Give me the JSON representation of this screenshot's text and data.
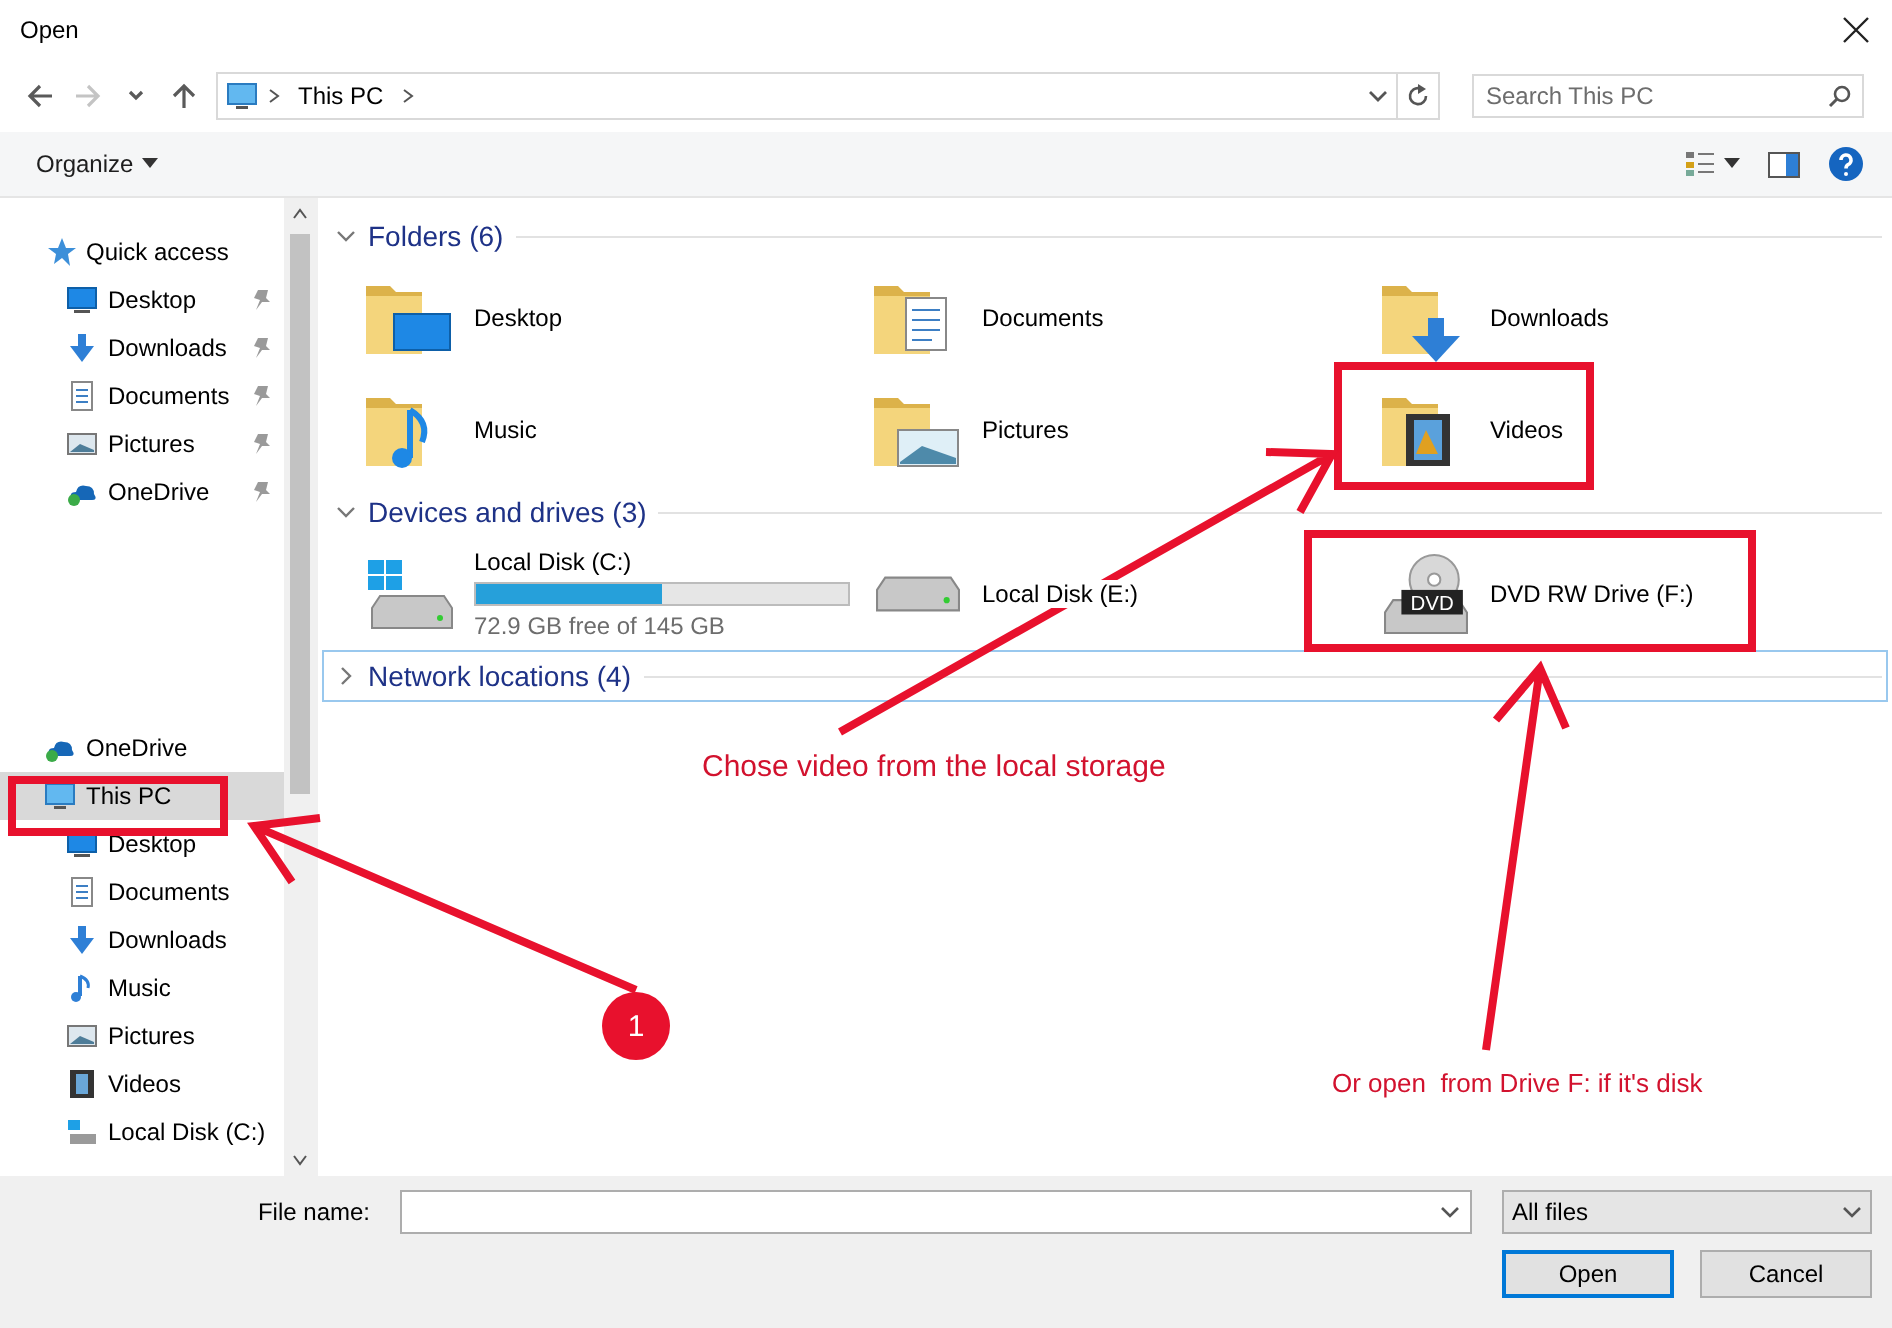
{
  "window": {
    "title": "Open"
  },
  "nav": {
    "buttons": [
      {
        "kind": "back",
        "disabled": false
      },
      {
        "kind": "forward",
        "disabled": true
      },
      {
        "kind": "recent",
        "disabled": false
      },
      {
        "kind": "up",
        "disabled": false
      }
    ],
    "address": {
      "path": [
        "This PC"
      ]
    },
    "search": {
      "placeholder": "Search This PC"
    }
  },
  "toolbar": {
    "organize": "Organize"
  },
  "sidebar": {
    "sections": [
      [
        {
          "label": "Quick access",
          "kind": "star",
          "selected": false,
          "children": [
            {
              "label": "Desktop",
              "kind": "desktop",
              "selected": false,
              "pinned": true
            },
            {
              "label": "Downloads",
              "kind": "downloads",
              "selected": false,
              "pinned": true
            },
            {
              "label": "Documents",
              "kind": "documents",
              "selected": false,
              "pinned": true
            },
            {
              "label": "Pictures",
              "kind": "pictures",
              "selected": false,
              "pinned": true
            },
            {
              "label": "OneDrive",
              "kind": "onedrive",
              "selected": false,
              "pinned": true
            }
          ]
        }
      ],
      [
        {
          "label": "OneDrive",
          "kind": "onedrive",
          "selected": false
        },
        {
          "label": "This PC",
          "kind": "pc",
          "selected": true,
          "children": [
            {
              "label": "Desktop",
              "kind": "desktop",
              "selected": false,
              "pinned": false
            },
            {
              "label": "Documents",
              "kind": "documents",
              "selected": false,
              "pinned": false
            },
            {
              "label": "Downloads",
              "kind": "downloads",
              "selected": false,
              "pinned": false
            },
            {
              "label": "Music",
              "kind": "music",
              "selected": false,
              "pinned": false
            },
            {
              "label": "Pictures",
              "kind": "pictures",
              "selected": false,
              "pinned": false
            },
            {
              "label": "Videos",
              "kind": "videos",
              "selected": false,
              "pinned": false
            },
            {
              "label": "Local Disk (C:)",
              "kind": "windows-disk",
              "selected": false,
              "pinned": false
            }
          ]
        }
      ]
    ]
  },
  "content": {
    "sections": [
      {
        "title": "Folders (6)",
        "expanded": true,
        "focused": false,
        "items": [
          {
            "name": "Desktop",
            "kind": "desktop"
          },
          {
            "name": "Documents",
            "kind": "documents"
          },
          {
            "name": "Downloads",
            "kind": "downloads"
          },
          {
            "name": "Music",
            "kind": "music"
          },
          {
            "name": "Pictures",
            "kind": "pictures"
          },
          {
            "name": "Videos",
            "kind": "videos"
          }
        ]
      },
      {
        "title": "Devices and drives (3)",
        "expanded": true,
        "focused": false,
        "items": [
          {
            "name": "Local Disk (C:)",
            "kind": "windows-disk",
            "level": 0.5,
            "detail": "72.9 GB free of 145 GB"
          },
          {
            "name": "Local Disk (E:)",
            "kind": "disk"
          },
          {
            "name": "DVD RW Drive (F:)",
            "kind": "dvd",
            "badge": "DVD"
          }
        ]
      },
      {
        "title": "Network locations (4)",
        "expanded": false,
        "focused": true
      }
    ]
  },
  "footer": {
    "file_name": {
      "label": "File name:"
    },
    "filter": {
      "value": "All files"
    },
    "buttons": [
      {
        "label": "Open",
        "default": true
      },
      {
        "label": "Cancel",
        "default": false
      }
    ]
  },
  "annotations": [
    {
      "kind": "number",
      "text": "1"
    },
    {
      "kind": "note",
      "text": "Chose video from the local storage"
    },
    {
      "kind": "note",
      "text": "Or open  from Drive F: if it's disk"
    }
  ]
}
